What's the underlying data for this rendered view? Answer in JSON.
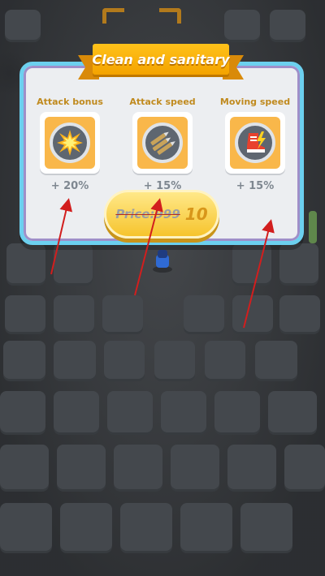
{
  "dialog": {
    "title": "Clean and sanitary",
    "stats": [
      {
        "label": "Attack bonus",
        "value": "+ 20%",
        "icon": "explosion-icon"
      },
      {
        "label": "Attack speed",
        "value": "+ 15%",
        "icon": "bullets-icon"
      },
      {
        "label": "Moving speed",
        "value": "+ 15%",
        "icon": "speed-boot-icon"
      }
    ],
    "buy_button": {
      "old_price": "Price:999",
      "new_price": "10"
    }
  },
  "colors": {
    "panel_border": "#6cd0ef",
    "ribbon": "#f4a300",
    "icon_tile": "#f9b74a",
    "stat_label": "#c08a1e",
    "button": "#f6c42d",
    "annotation_arrow": "#d21e1e"
  }
}
